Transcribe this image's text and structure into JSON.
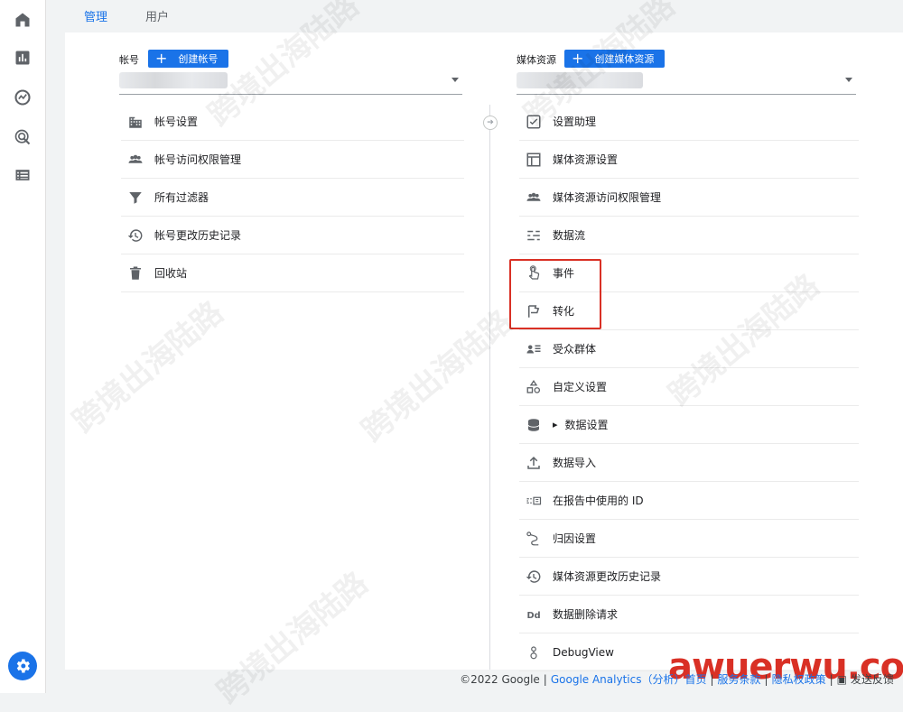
{
  "tabs": [
    {
      "label": "管理"
    },
    {
      "label": "用户"
    }
  ],
  "account": {
    "label": "帐号",
    "create_label": "创建帐号",
    "items": [
      {
        "label": "帐号设置",
        "icon": "building-icon"
      },
      {
        "label": "帐号访问权限管理",
        "icon": "people-icon"
      },
      {
        "label": "所有过滤器",
        "icon": "filter-icon"
      },
      {
        "label": "帐号更改历史记录",
        "icon": "history-icon"
      },
      {
        "label": "回收站",
        "icon": "trash-icon"
      }
    ]
  },
  "property": {
    "label": "媒体资源",
    "create_label": "创建媒体资源",
    "items": [
      {
        "label": "设置助理",
        "icon": "checkbox-icon"
      },
      {
        "label": "媒体资源设置",
        "icon": "layout-icon"
      },
      {
        "label": "媒体资源访问权限管理",
        "icon": "people-icon"
      },
      {
        "label": "数据流",
        "icon": "streams-icon"
      },
      {
        "label": "事件",
        "icon": "touch-icon"
      },
      {
        "label": "转化",
        "icon": "flag-icon"
      },
      {
        "label": "受众群体",
        "icon": "audience-icon"
      },
      {
        "label": "自定义设置",
        "icon": "shapes-icon"
      },
      {
        "label": "数据设置",
        "icon": "database-icon"
      },
      {
        "label": "数据导入",
        "icon": "upload-icon"
      },
      {
        "label": "在报告中使用的 ID",
        "icon": "id-icon"
      },
      {
        "label": "归因设置",
        "icon": "attribution-icon"
      },
      {
        "label": "媒体资源更改历史记录",
        "icon": "history-icon"
      },
      {
        "label": "数据删除请求",
        "icon": "dd-icon"
      },
      {
        "label": "DebugView",
        "icon": "debug-icon"
      }
    ]
  },
  "footer": {
    "copyright": "©2022 Google",
    "sep": "|",
    "ga": "Google Analytics（分析）首页",
    "terms": "服务条款",
    "privacy": "隐私权政策",
    "feedback": "发送反馈"
  },
  "watermark_brand": "awuerwu.com",
  "watermark_text": "跨境出海陆路",
  "colors": {
    "accent": "#1a73e8",
    "highlight": "#d93025"
  }
}
